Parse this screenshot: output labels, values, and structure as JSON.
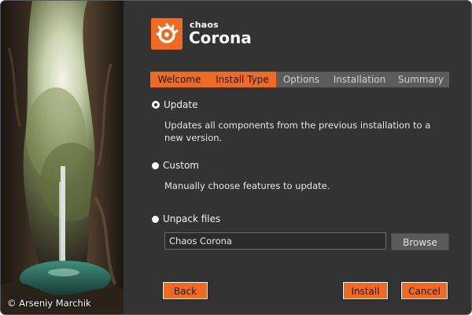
{
  "photo": {
    "credit": "© Arseniy Marchik"
  },
  "brand": {
    "small": "chaos",
    "name": "Corona",
    "accent_color": "#f26a21",
    "logo_icon": "corona-flame-icon"
  },
  "tabs": [
    {
      "label": "Welcome",
      "active": true
    },
    {
      "label": "Install Type",
      "active": true
    },
    {
      "label": "Options",
      "active": false
    },
    {
      "label": "Installation",
      "active": false
    },
    {
      "label": "Summary",
      "active": false
    }
  ],
  "options": {
    "update": {
      "label": "Update",
      "selected": true,
      "description": "Updates all components from the previous installation to a new version."
    },
    "custom": {
      "label": "Custom",
      "selected": false,
      "description": "Manually choose features to update."
    },
    "unpack": {
      "label": "Unpack files",
      "selected": false,
      "path_value": "Chaos Corona",
      "browse_label": "Browse"
    }
  },
  "footer": {
    "back_label": "Back",
    "install_label": "Install",
    "cancel_label": "Cancel"
  }
}
